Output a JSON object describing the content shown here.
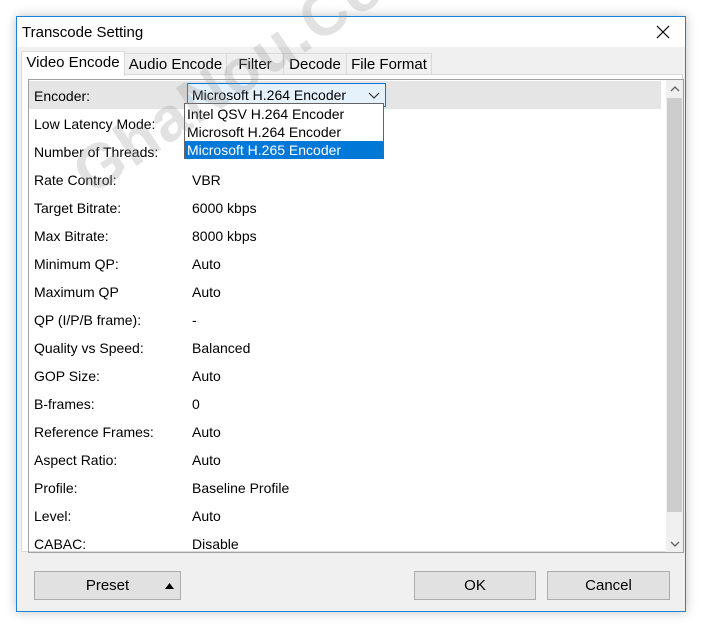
{
  "window": {
    "title": "Transcode Setting"
  },
  "tabs": [
    {
      "label": "Video Encode",
      "active": true
    },
    {
      "label": "Audio Encode",
      "active": false
    },
    {
      "label": "Filter",
      "active": false
    },
    {
      "label": "Decode",
      "active": false
    },
    {
      "label": "File Format",
      "active": false
    }
  ],
  "encoder": {
    "label": "Encoder:",
    "selected": "Microsoft H.264 Encoder",
    "options": [
      "Intel QSV H.264 Encoder",
      "Microsoft H.264 Encoder",
      "Microsoft H.265 Encoder"
    ],
    "highlighted_option": "Microsoft H.265 Encoder"
  },
  "settings": [
    {
      "label": "Low Latency Mode:",
      "value": ""
    },
    {
      "label": "Number of Threads:",
      "value": ""
    },
    {
      "label": "Rate Control:",
      "value": "VBR"
    },
    {
      "label": "Target Bitrate:",
      "value": "6000 kbps"
    },
    {
      "label": "Max Bitrate:",
      "value": "8000 kbps"
    },
    {
      "label": "Minimum QP:",
      "value": "Auto"
    },
    {
      "label": "Maximum QP",
      "value": "Auto"
    },
    {
      "label": "QP (I/P/B frame):",
      "value": "-"
    },
    {
      "label": "Quality vs Speed:",
      "value": "Balanced"
    },
    {
      "label": "GOP Size:",
      "value": "Auto"
    },
    {
      "label": "B-frames:",
      "value": "0"
    },
    {
      "label": "Reference Frames:",
      "value": "Auto"
    },
    {
      "label": "Aspect Ratio:",
      "value": "Auto"
    },
    {
      "label": "Profile:",
      "value": "Baseline Profile"
    },
    {
      "label": "Level:",
      "value": "Auto"
    },
    {
      "label": "CABAC:",
      "value": "Disable"
    }
  ],
  "buttons": {
    "preset": "Preset",
    "ok": "OK",
    "cancel": "Cancel"
  },
  "watermark": "GhaNou.CoM",
  "colors": {
    "accent": "#0078d7",
    "window_border": "#1883d7",
    "dialog_bg": "#f0f0f0"
  }
}
